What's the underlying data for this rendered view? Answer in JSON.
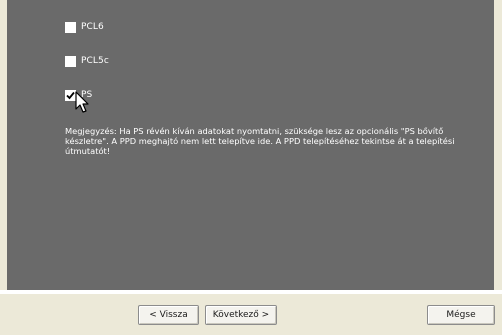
{
  "options": [
    {
      "label": "PCL6",
      "checked": false
    },
    {
      "label": "PCL5c",
      "checked": false
    },
    {
      "label": "PS",
      "checked": true
    }
  ],
  "note": "Megjegyzés: Ha PS révén kíván adatokat nyomtatni, szüksége lesz az opcionális \"PS bővítő készletre\". A PPD meghajtó nem lett telepítve ide. A PPD telepítéséhez tekintse át a telepítési útmutatót!",
  "buttons": {
    "back": "< Vissza",
    "next": "Következő >",
    "cancel": "Mégse"
  },
  "colors": {
    "panel": "#6a6a6a",
    "button_bar": "#ece9d8"
  },
  "icons": {
    "checkmark": "checkmark-icon",
    "cursor": "mouse-pointer-icon"
  }
}
